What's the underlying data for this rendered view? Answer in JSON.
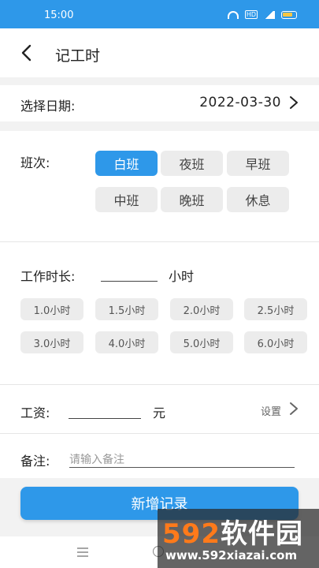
{
  "status_bar": {
    "time": "15:00",
    "hd_label": "HD"
  },
  "header": {
    "title": "记工时"
  },
  "date": {
    "label": "选择日期:",
    "value": "2022-03-30"
  },
  "shift": {
    "label": "班次:",
    "options": [
      "白班",
      "夜班",
      "早班",
      "中班",
      "晚班",
      "休息"
    ],
    "selected": "白班"
  },
  "work_hours": {
    "label": "工作时长:",
    "value": "",
    "unit": "小时",
    "presets": [
      "1.0小时",
      "1.5小时",
      "2.0小时",
      "2.5小时",
      "3.0小时",
      "4.0小时",
      "5.0小时",
      "6.0小时"
    ]
  },
  "wage": {
    "label": "工资:",
    "value": "",
    "unit": "元",
    "settings_label": "设置"
  },
  "remark": {
    "label": "备注:",
    "placeholder": "请输入备注"
  },
  "actions": {
    "add_label": "新增记录"
  },
  "watermark": {
    "brand_number": "592",
    "brand_text": "软件园",
    "url": "www.592xiazai.com"
  },
  "colors": {
    "accent": "#2e98e9",
    "background_gap": "#f2f2f2",
    "chip": "#ececec"
  }
}
